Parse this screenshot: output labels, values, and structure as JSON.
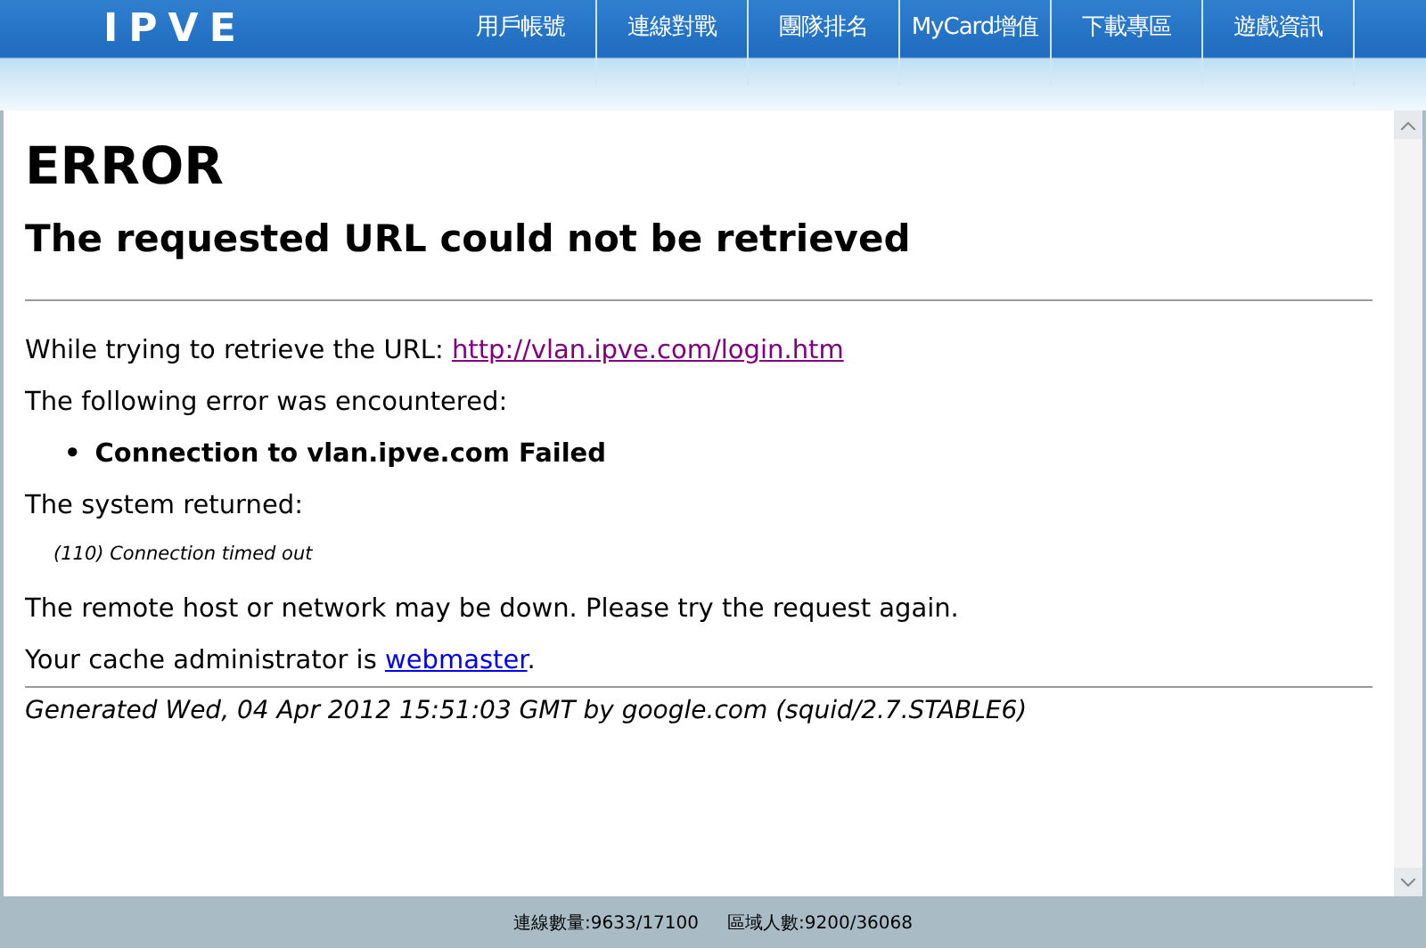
{
  "logo": "IPVE",
  "nav": [
    {
      "label": "用戶帳號"
    },
    {
      "label": "連線對戰"
    },
    {
      "label": "團隊排名"
    },
    {
      "label": "MyCard增值"
    },
    {
      "label": "下載專區"
    },
    {
      "label": "遊戲資訊"
    }
  ],
  "error_page": {
    "heading": "ERROR",
    "subheading": "The requested URL could not be retrieved",
    "retrieve_text": "While trying to retrieve the URL:",
    "url": "http://vlan.ipve.com/login.htm",
    "error_intro": "The following error was encountered:",
    "errors": [
      {
        "bullet": "•",
        "text": "Connection to vlan.ipve.com Failed"
      }
    ],
    "system_intro": "The system returned:",
    "system_message": "(110) Connection timed out",
    "advice": "The remote host or network may be down. Please try the request again.",
    "admin_text": "Your cache administrator is",
    "admin_link": "webmaster",
    "admin_suffix": ".",
    "generated": "Generated Wed, 04 Apr 2012 15:51:03 GMT by google.com (squid/2.7.STABLE6)"
  },
  "status_bar": [
    "連線數量:9633/17100",
    "區域人數:9200/36068"
  ]
}
